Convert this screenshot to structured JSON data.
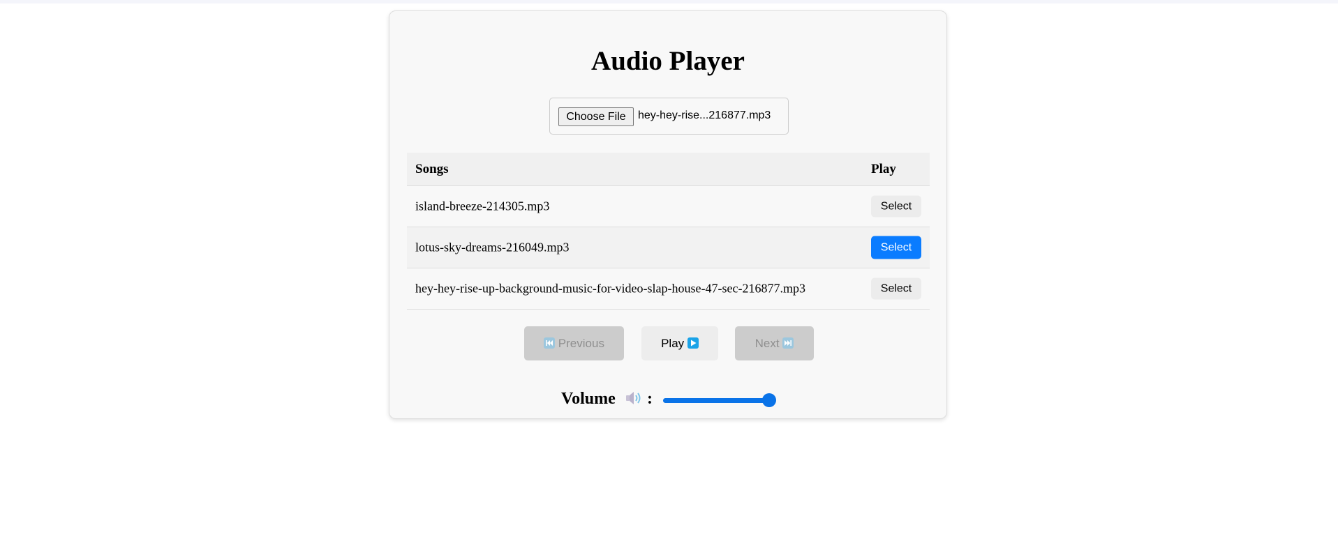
{
  "player": {
    "title": "Audio Player",
    "file_input": {
      "button_label": "Choose File",
      "file_name": "hey-hey-rise...216877.mp3"
    },
    "table": {
      "headers": [
        "Songs",
        "Play"
      ],
      "rows": [
        {
          "name": "island-breeze-214305.mp3",
          "action": "Select",
          "selected": false
        },
        {
          "name": "lotus-sky-dreams-216049.mp3",
          "action": "Select",
          "selected": true
        },
        {
          "name": "hey-hey-rise-up-background-music-for-video-slap-house-47-sec-216877.mp3",
          "action": "Select",
          "selected": false
        }
      ]
    },
    "controls": {
      "previous_label": "Previous",
      "play_label": "Play",
      "next_label": "Next",
      "previous_icon": "previous-track-icon",
      "play_icon": "play-icon",
      "next_icon": "next-track-icon",
      "previous_disabled": true,
      "next_disabled": true
    },
    "volume": {
      "label": "Volume",
      "separator": ":",
      "icon": "speaker-icon",
      "level": 1.0
    }
  },
  "colors": {
    "accent": "#0a7cff",
    "slider": "#0a73e8",
    "disabled_button": "#cccccc",
    "icon_blue": "#1aa3e8"
  }
}
